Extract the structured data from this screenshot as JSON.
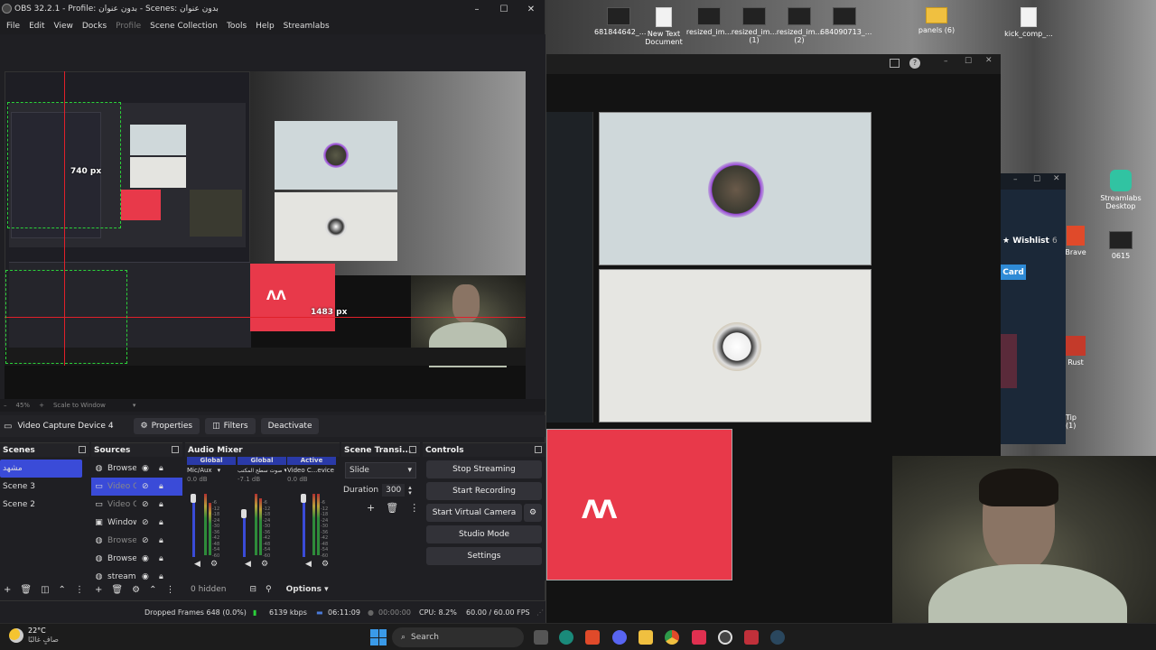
{
  "obs": {
    "title": "OBS 32.2.1 - Profile: بدون عنوان - Scenes: بدون عنوان",
    "menu": [
      "File",
      "Edit",
      "View",
      "Docks",
      "Profile",
      "Scene Collection",
      "Tools",
      "Help",
      "Streamlabs"
    ],
    "preview_labels": {
      "width_px": "740 px",
      "height_px": "1483 px"
    },
    "zoom": {
      "level": "45%",
      "mode": "Scale to Window"
    },
    "source_bar": {
      "source_name": "Video Capture Device 4",
      "properties": "Properties",
      "filters": "Filters",
      "deactivate": "Deactivate"
    },
    "scenes": {
      "title": "Scenes",
      "items": [
        "مشهد",
        "Scene 3",
        "Scene 2"
      ]
    },
    "sources": {
      "title": "Sources",
      "items": [
        "Browser",
        "Video C",
        "Video C",
        "Window",
        "Browser",
        "Browser",
        "streamli"
      ]
    },
    "audio_mixer": {
      "title": "Audio Mixer",
      "headers": [
        "Global",
        "Global",
        "Active"
      ],
      "channels": [
        {
          "name": "Mic/Aux",
          "db": "0.0 dB"
        },
        {
          "name": "صوت سطح المكتب",
          "db": "-7.1 dB"
        },
        {
          "name": "Video C...evice 2",
          "db": "0.0 dB"
        }
      ],
      "ticks": [
        "-6",
        "-12",
        "-18",
        "-24",
        "-30",
        "-36",
        "-42",
        "-48",
        "-54",
        "-60"
      ],
      "hidden": "0 hidden",
      "options": "Options"
    },
    "transitions": {
      "title": "Scene Transi...",
      "selected": "Slide",
      "duration_label": "Duration",
      "duration_value": "300"
    },
    "controls": {
      "title": "Controls",
      "buttons": [
        "Stop Streaming",
        "Start Recording",
        "Start Virtual Camera",
        "Studio Mode",
        "Settings"
      ]
    },
    "status": {
      "dropped": "Dropped Frames 648 (0.0%)",
      "bitrate": "6139 kbps",
      "stream_time": "06:11:09",
      "rec_time": "00:00:00",
      "cpu": "CPU: 8.2%",
      "fps": "60.00 / 60.00 FPS"
    }
  },
  "desktop": {
    "icons": [
      "681844642_...",
      "New Text Document",
      "resized_im...",
      "resized_im... (1)",
      "resized_im... (2)",
      "684090713_...",
      "panels (6)",
      "kick_comp_..."
    ],
    "side_icons": [
      "Streamlabs Desktop",
      "Brave",
      "0615",
      "Rust"
    ]
  },
  "steam": {
    "wishlist": "Wishlist",
    "wishlist_count": "6",
    "card": "Card",
    "tip": "Tip (1)"
  },
  "taskbar": {
    "weather_temp": "22°C",
    "weather_text": "صافٍ غالبًا",
    "search": "Search"
  }
}
